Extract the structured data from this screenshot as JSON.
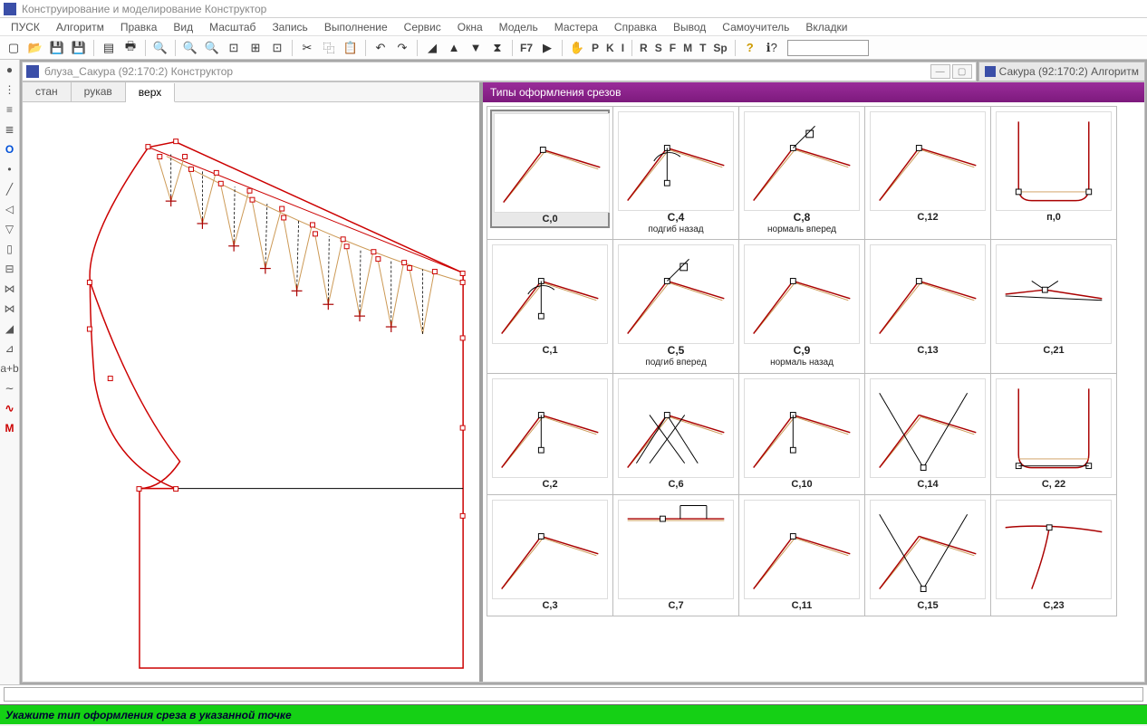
{
  "window_title": "Конструирование и моделирование  Конструктор",
  "menu": [
    "ПУСК",
    "Алгоритм",
    "Правка",
    "Вид",
    "Масштаб",
    "Запись",
    "Выполнение",
    "Сервис",
    "Окна",
    "Модель",
    "Мастера",
    "Справка",
    "Вывод",
    "Самоучитель",
    "Вкладки"
  ],
  "toolbar_text_buttons": [
    "F7",
    "P",
    "K",
    "I",
    "R",
    "S",
    "F",
    "M",
    "T",
    "Sp"
  ],
  "mdi_title": "блуза_Сакура (92:170:2) Конструктор",
  "mdi_right_tab": "Сакура (92:170:2) Алгоритм",
  "tabs": [
    {
      "label": "стан",
      "active": false
    },
    {
      "label": "рукав",
      "active": false
    },
    {
      "label": "верх",
      "active": true
    }
  ],
  "right_panel_title": "Типы оформления срезов",
  "cells": [
    [
      {
        "code": "С,0",
        "sub": "",
        "sel": true
      },
      {
        "code": "С,4",
        "sub": "подгиб назад"
      },
      {
        "code": "С,8",
        "sub": "нормаль вперед"
      },
      {
        "code": "С,12",
        "sub": ""
      },
      {
        "code": "п,0",
        "sub": ""
      }
    ],
    [
      {
        "code": "С,1",
        "sub": ""
      },
      {
        "code": "С,5",
        "sub": "подгиб вперед"
      },
      {
        "code": "С,9",
        "sub": "нормаль назад"
      },
      {
        "code": "С,13",
        "sub": ""
      },
      {
        "code": "С,21",
        "sub": ""
      }
    ],
    [
      {
        "code": "С,2",
        "sub": ""
      },
      {
        "code": "С,6",
        "sub": ""
      },
      {
        "code": "С,10",
        "sub": ""
      },
      {
        "code": "С,14",
        "sub": ""
      },
      {
        "code": "С, 22",
        "sub": ""
      }
    ],
    [
      {
        "code": "С,3",
        "sub": ""
      },
      {
        "code": "С,7",
        "sub": ""
      },
      {
        "code": "С,11",
        "sub": ""
      },
      {
        "code": "С,15",
        "sub": ""
      },
      {
        "code": "С,23",
        "sub": ""
      }
    ]
  ],
  "status_text": "Укажите тип оформления среза в указанной точке",
  "left_tool_icons": [
    "●",
    "⋮",
    "≡",
    "≣",
    "O",
    "•",
    "╱",
    "◁",
    "▽",
    "▯",
    "⊟",
    "⋈",
    "⋈",
    "◢",
    "⊿",
    "a+b",
    "∼",
    "∿",
    "M"
  ]
}
